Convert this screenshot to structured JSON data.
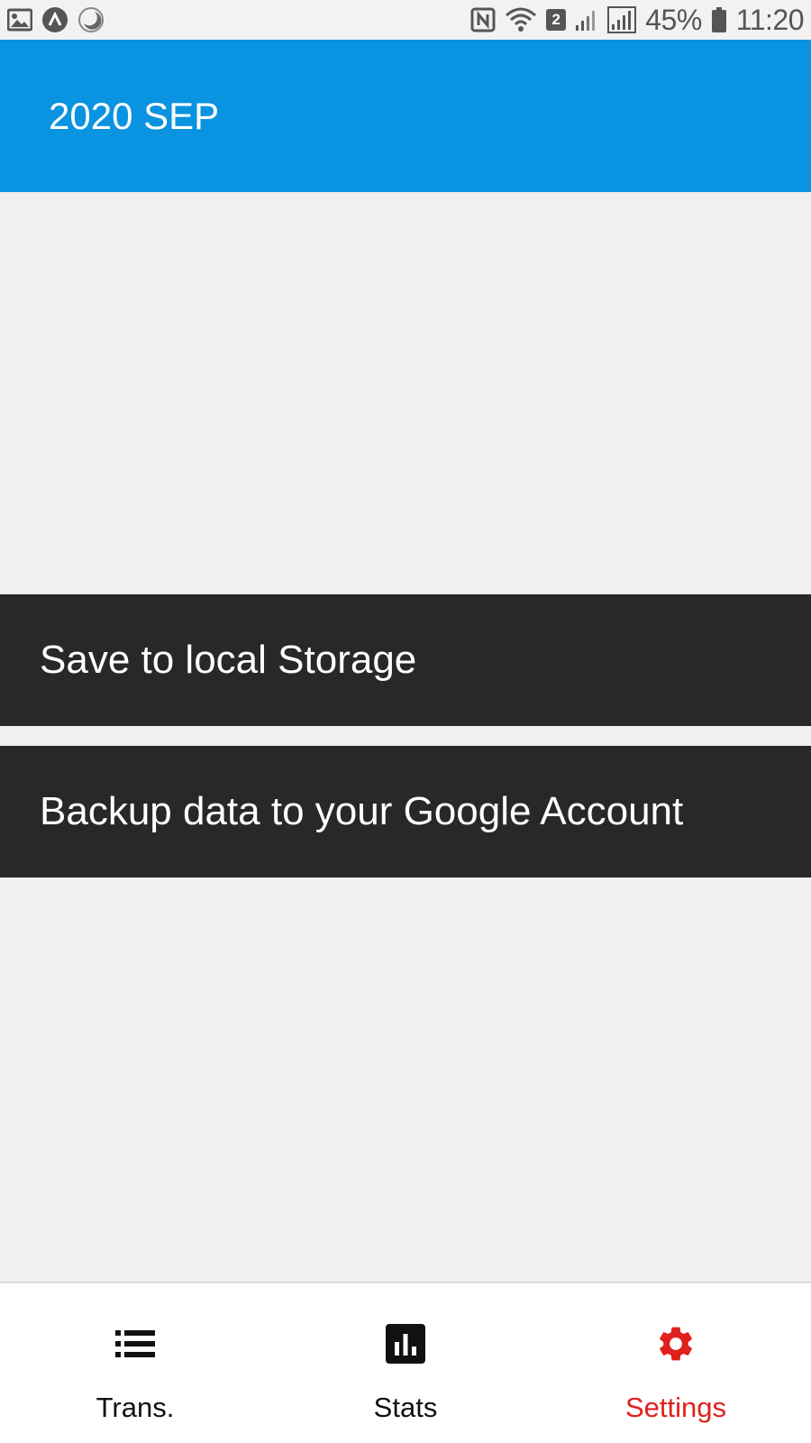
{
  "status_bar": {
    "icons_left": [
      "image-icon",
      "app-badge-icon",
      "night-mode-icon"
    ],
    "icons_right": [
      "nfc-icon",
      "wifi-icon",
      "sim2-icon",
      "signal-icon",
      "signal-icon"
    ],
    "sim_badge": "2",
    "battery_percent": "45%",
    "time": "11:20"
  },
  "app_bar": {
    "title": "2020 SEP",
    "background": "#0993e1"
  },
  "actions": {
    "save_local": "Save to local Storage",
    "backup_google": "Backup data to your Google Account"
  },
  "bottom_nav": {
    "items": [
      {
        "label": "Trans.",
        "icon": "list-icon",
        "active": false
      },
      {
        "label": "Stats",
        "icon": "bar-chart-icon",
        "active": false
      },
      {
        "label": "Settings",
        "icon": "gear-icon",
        "active": true
      }
    ],
    "active_color": "#e0201c"
  }
}
